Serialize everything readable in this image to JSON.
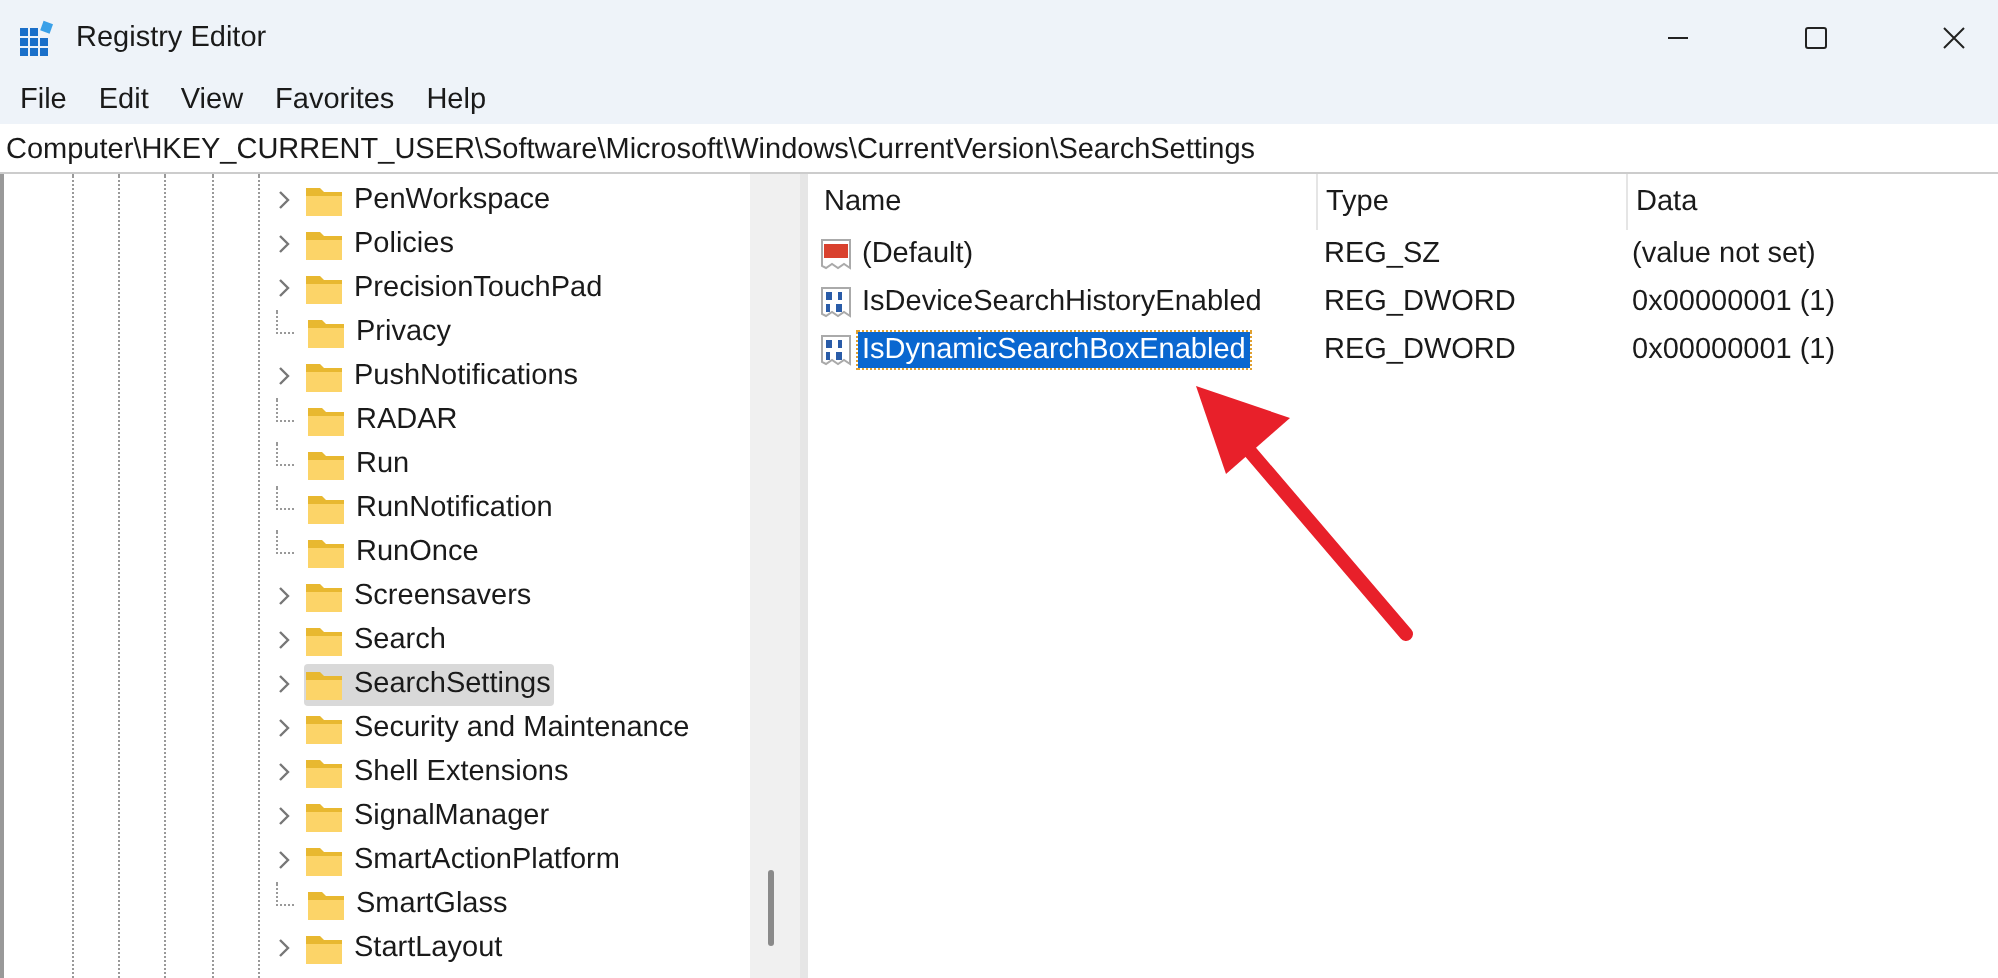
{
  "window": {
    "title": "Registry Editor"
  },
  "menu": [
    "File",
    "Edit",
    "View",
    "Favorites",
    "Help"
  ],
  "address": "Computer\\HKEY_CURRENT_USER\\Software\\Microsoft\\Windows\\CurrentVersion\\SearchSettings",
  "tree": [
    {
      "label": "PenWorkspace",
      "expandable": true,
      "selected": false
    },
    {
      "label": "Policies",
      "expandable": true,
      "selected": false
    },
    {
      "label": "PrecisionTouchPad",
      "expandable": true,
      "selected": false
    },
    {
      "label": "Privacy",
      "expandable": false,
      "selected": false
    },
    {
      "label": "PushNotifications",
      "expandable": true,
      "selected": false
    },
    {
      "label": "RADAR",
      "expandable": false,
      "selected": false
    },
    {
      "label": "Run",
      "expandable": false,
      "selected": false
    },
    {
      "label": "RunNotification",
      "expandable": false,
      "selected": false
    },
    {
      "label": "RunOnce",
      "expandable": false,
      "selected": false
    },
    {
      "label": "Screensavers",
      "expandable": true,
      "selected": false
    },
    {
      "label": "Search",
      "expandable": true,
      "selected": false
    },
    {
      "label": "SearchSettings",
      "expandable": true,
      "selected": true
    },
    {
      "label": "Security and Maintenance",
      "expandable": true,
      "selected": false
    },
    {
      "label": "Shell Extensions",
      "expandable": true,
      "selected": false
    },
    {
      "label": "SignalManager",
      "expandable": true,
      "selected": false
    },
    {
      "label": "SmartActionPlatform",
      "expandable": true,
      "selected": false
    },
    {
      "label": "SmartGlass",
      "expandable": false,
      "selected": false
    },
    {
      "label": "StartLayout",
      "expandable": true,
      "selected": false
    }
  ],
  "table": {
    "columns": [
      "Name",
      "Type",
      "Data"
    ],
    "rows": [
      {
        "kind": "string",
        "name": "(Default)",
        "type": "REG_SZ",
        "data": "(value not set)",
        "selected": false
      },
      {
        "kind": "binary",
        "name": "IsDeviceSearchHistoryEnabled",
        "type": "REG_DWORD",
        "data": "0x00000001 (1)",
        "selected": false
      },
      {
        "kind": "binary",
        "name": "IsDynamicSearchBoxEnabled",
        "type": "REG_DWORD",
        "data": "0x00000001 (1)",
        "selected": true
      }
    ]
  }
}
